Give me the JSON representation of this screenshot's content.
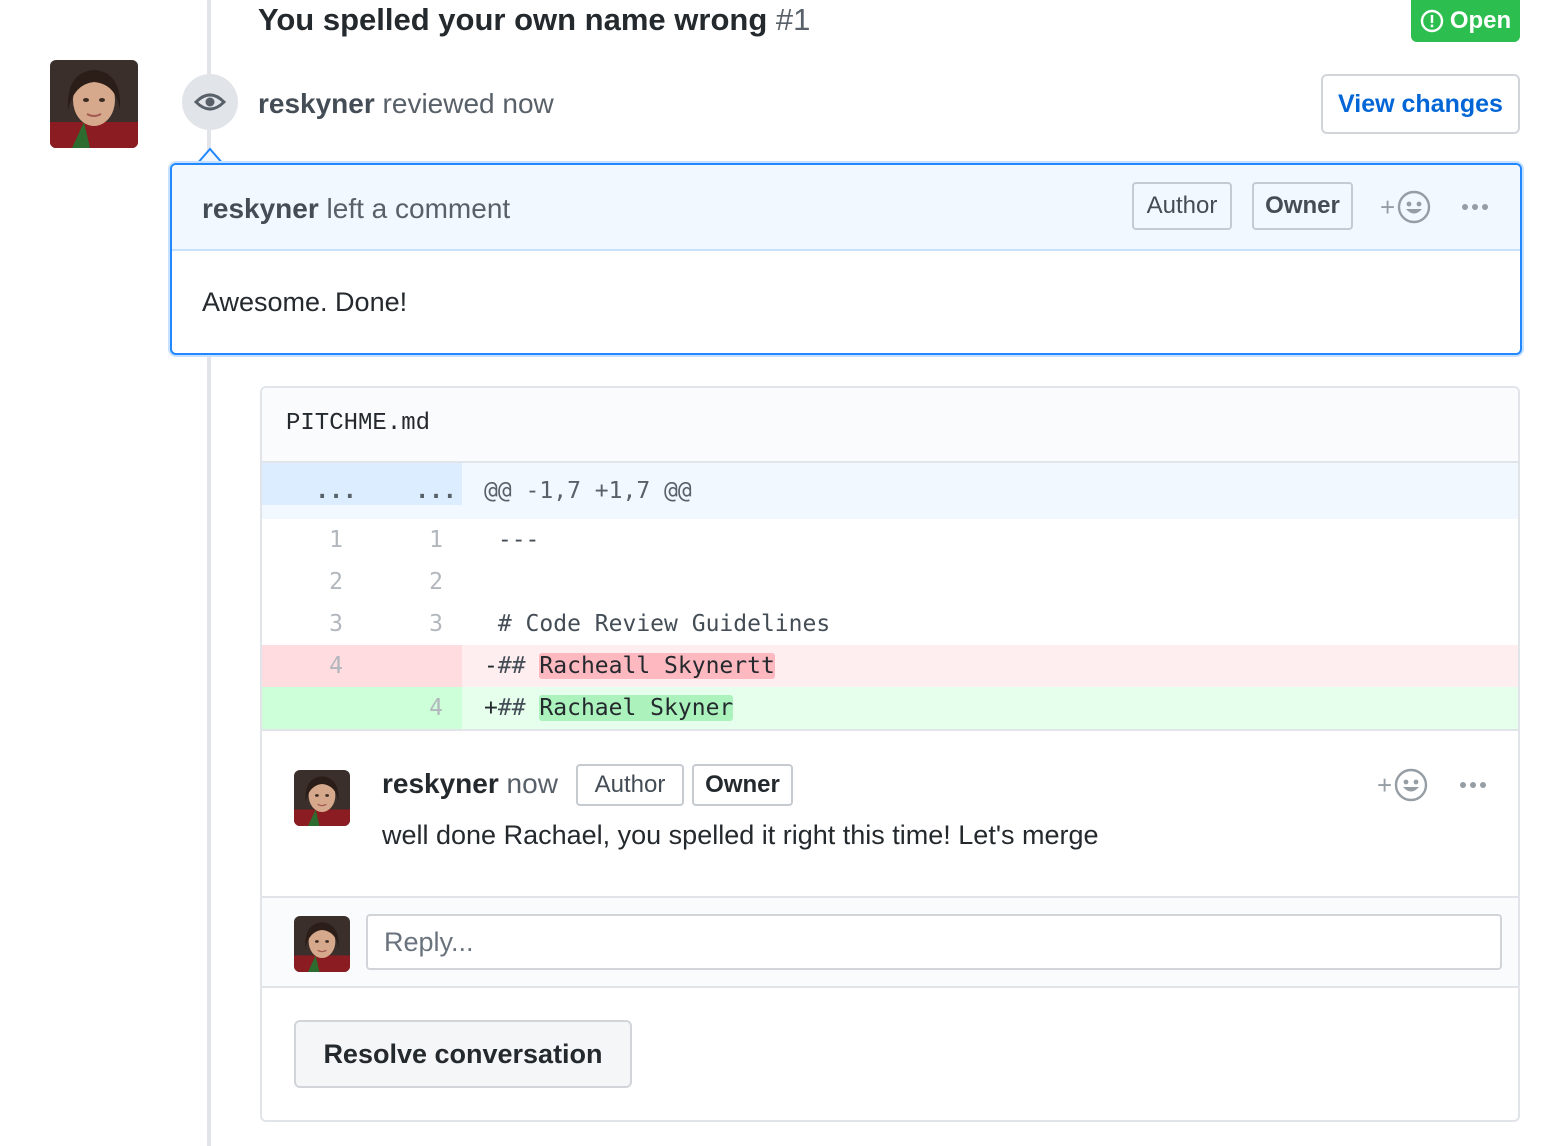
{
  "pr": {
    "title": "You spelled your own name wrong",
    "number": "#1",
    "state": "Open"
  },
  "review": {
    "user": "reskyner",
    "action": "reviewed now",
    "view_changes_label": "View changes"
  },
  "review_comment": {
    "user": "reskyner",
    "action": "left a comment",
    "labels": [
      "Author",
      "Owner"
    ],
    "reaction_plus": "+",
    "body": "Awesome. Done!"
  },
  "file": {
    "name": "PITCHME.md",
    "hunk": {
      "old": "...",
      "new": "...",
      "header": "@@ -1,7 +1,7 @@"
    },
    "lines": [
      {
        "old": "1",
        "new": "1",
        "sign": " ",
        "prefix": "---",
        "highlight": ""
      },
      {
        "old": "2",
        "new": "2",
        "sign": " ",
        "prefix": "",
        "highlight": ""
      },
      {
        "old": "3",
        "new": "3",
        "sign": " ",
        "prefix": "# Code Review Guidelines",
        "highlight": ""
      },
      {
        "old": "4",
        "new": "",
        "sign": "-",
        "prefix": "## ",
        "highlight": "Racheall Skynertt"
      },
      {
        "old": "",
        "new": "4",
        "sign": "+",
        "prefix": "## ",
        "highlight": "Rachael Skyner"
      }
    ]
  },
  "thread": {
    "user": "reskyner",
    "time": "now",
    "labels": [
      "Author",
      "Owner"
    ],
    "reaction_plus": "+",
    "body": "well done Rachael, you spelled it right this time! Let's merge",
    "reply_placeholder": "Reply...",
    "resolve_label": "Resolve conversation"
  },
  "colors": {
    "open_green": "#2cbe4e",
    "link_blue": "#0366d6",
    "focus_blue": "#2188ff",
    "deletion_bg": "#ffeef0",
    "addition_bg": "#e6ffed"
  },
  "icons": [
    "issue-opened-icon",
    "eye-icon",
    "smiley-icon",
    "kebab-horizontal-icon",
    "avatar-image"
  ]
}
